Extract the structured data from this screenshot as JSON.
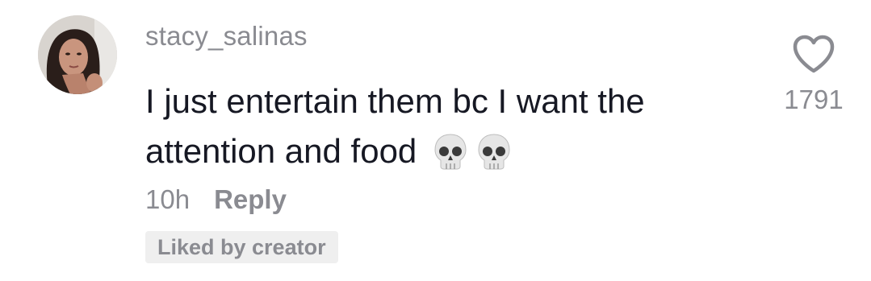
{
  "comment": {
    "username": "stacy_salinas",
    "text": "I just entertain them bc I want the attention and food",
    "emojis": [
      "skull-emoji",
      "skull-emoji"
    ],
    "time_ago": "10h",
    "reply_label": "Reply",
    "badge": "Liked by creator",
    "like_count": "1791",
    "like_icon": "heart-outline-icon"
  }
}
